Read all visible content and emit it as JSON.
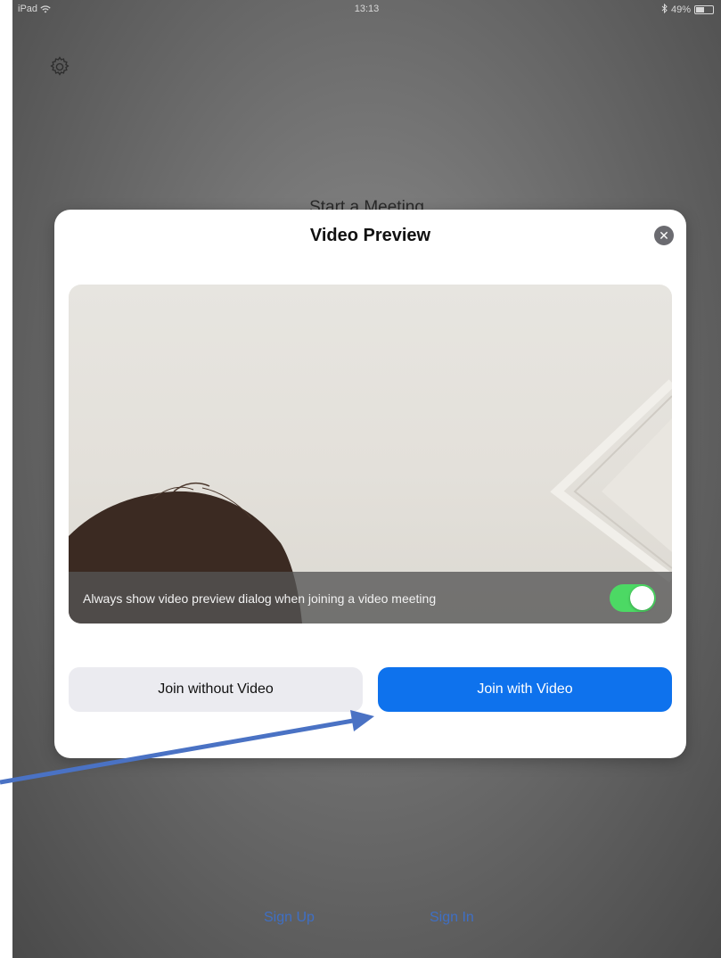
{
  "status_bar": {
    "device": "iPad",
    "time": "13:13",
    "battery": "49%",
    "battery_level": 0.49
  },
  "background": {
    "title": "Start a Meeting",
    "sign_up": "Sign Up",
    "sign_in": "Sign In"
  },
  "dialog": {
    "title": "Video Preview",
    "preview_caption": "Always show video preview dialog when joining a video meeting",
    "toggle_on": true,
    "join_without_video": "Join without Video",
    "join_with_video": "Join with Video"
  },
  "colors": {
    "primary_button": "#0e72ed",
    "toggle_on": "#4cd964",
    "link": "#3f6fc4",
    "annotation_arrow": "#4a72c4"
  },
  "icons": [
    "wifi-icon",
    "bluetooth-icon",
    "battery-icon",
    "settings-gear-icon",
    "close-icon",
    "annotation-arrow"
  ]
}
